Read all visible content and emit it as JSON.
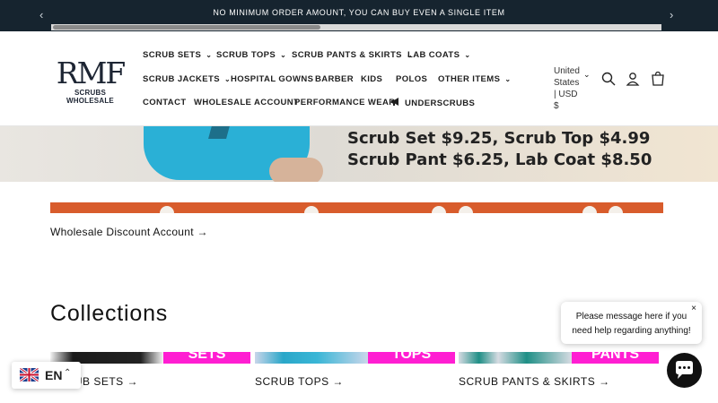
{
  "announcement": {
    "text": "NO MINIMUM ORDER AMOUNT, YOU CAN BUY EVEN A SINGLE ITEM",
    "prev_icon": "chevron-left-icon",
    "next_icon": "chevron-right-icon"
  },
  "logo": {
    "main": "RMF",
    "sub": "SCRUBS WHOLESALE"
  },
  "nav": {
    "scrub_sets": "SCRUB SETS",
    "scrub_tops": "SCRUB TOPS",
    "scrub_pants": "SCRUB PANTS & SKIRTS",
    "lab_coats": "LAB COATS",
    "scrub_jackets": "SCRUB JACKETS",
    "hospital_gowns": "HOSPITAL GOWNS",
    "barber": "BARBER",
    "kids": "KIDS",
    "polos": "POLOS",
    "other_items": "OTHER ITEMS",
    "contact": "CONTACT",
    "wholesale_account": "WHOLESALE ACCOUNT",
    "performance_wear": "PERFORMANCE WEAR",
    "underscrubs": "UNDERSCRUBS"
  },
  "locale": {
    "line1": "United",
    "line2": "States",
    "line3": "| USD",
    "line4": "$"
  },
  "icons": {
    "search": "search-icon",
    "account": "account-icon",
    "cart": "cart-icon",
    "megaphone": "megaphone-icon"
  },
  "banner": {
    "line1": "Scrub Set $9.25, Scrub Top $4.99",
    "line2": "Scrub Pant $6.25, Lab Coat $8.50"
  },
  "wholesale_link": "Wholesale Discount Account →",
  "collections": {
    "title": "Collections",
    "items": [
      {
        "label": "SCRUB SETS →",
        "tag": "SETS"
      },
      {
        "label": "SCRUB TOPS →",
        "tag": "TOPS"
      },
      {
        "label": "SCRUB PANTS & SKIRTS →",
        "tag": "PANTS"
      }
    ]
  },
  "language": {
    "code": "EN"
  },
  "chat": {
    "line1": "Please message here if you",
    "line2": "need help regarding anything!",
    "close": "×"
  },
  "colors": {
    "announcement_bg": "#16242f",
    "discount_strip": "#d85c2c",
    "collection_tag": "#ff1ed2",
    "chat_button": "#111111"
  }
}
